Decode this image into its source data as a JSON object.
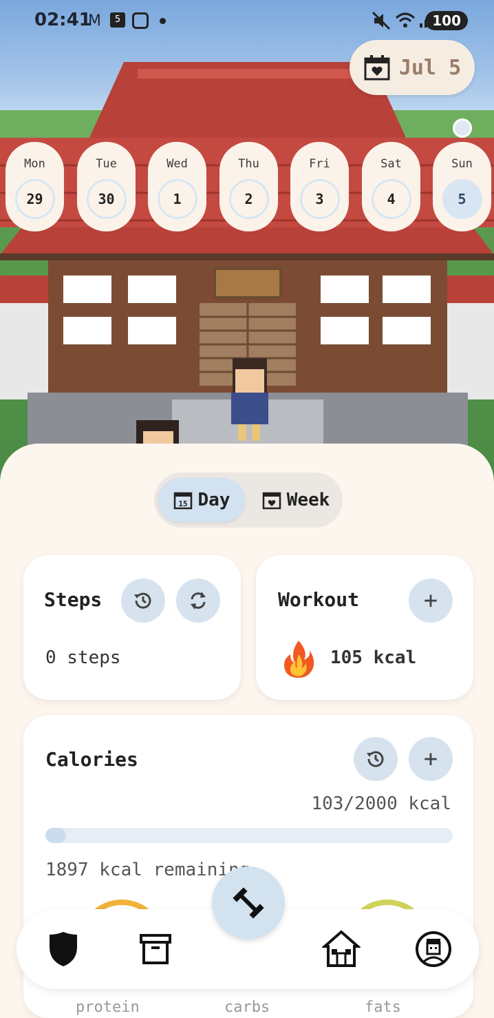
{
  "status": {
    "time": "02:41",
    "battery": "100",
    "icons": [
      "gmail-icon",
      "calendar-5-icon",
      "instagram-icon",
      "dot-icon",
      "mute-icon",
      "wifi-icon",
      "signal-icon"
    ]
  },
  "header": {
    "date_chip": "Jul 5"
  },
  "week": {
    "days": [
      {
        "name": "Mon",
        "num": "29"
      },
      {
        "name": "Tue",
        "num": "30"
      },
      {
        "name": "Wed",
        "num": "1"
      },
      {
        "name": "Thu",
        "num": "2"
      },
      {
        "name": "Fri",
        "num": "3"
      },
      {
        "name": "Sat",
        "num": "4"
      },
      {
        "name": "Sun",
        "num": "5",
        "selected": true
      }
    ]
  },
  "toggle": {
    "day_label": "Day",
    "week_label": "Week",
    "day_icon_num": "15",
    "selected": "Day"
  },
  "steps_card": {
    "title": "Steps",
    "value": "0 steps"
  },
  "workout_card": {
    "title": "Workout",
    "value": "105 kcal",
    "add": "+"
  },
  "calories_card": {
    "title": "Calories",
    "summary": "103/2000 kcal",
    "progress_fraction": 0.05,
    "remaining": "1897 kcal remaining",
    "add": "+",
    "macros": [
      "protein",
      "carbs",
      "fats"
    ]
  },
  "colors": {
    "panel": "#fdf6ee",
    "accent": "#d6e3ef",
    "selected_day": "#d8e6f3"
  }
}
